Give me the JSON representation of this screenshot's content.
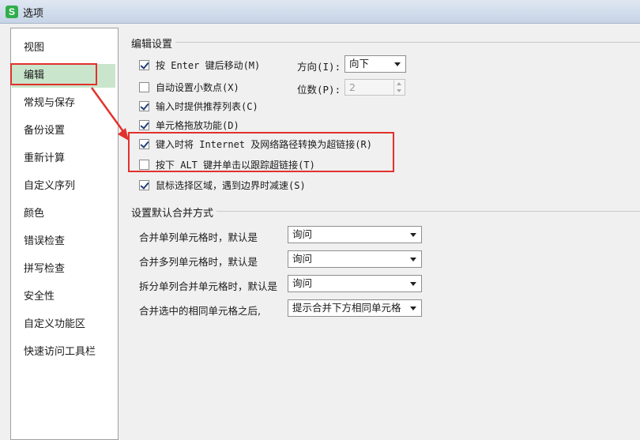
{
  "window": {
    "logo_letter": "S",
    "title": "选项"
  },
  "sidebar": {
    "items": [
      {
        "label": "视图"
      },
      {
        "label": "编辑"
      },
      {
        "label": "常规与保存"
      },
      {
        "label": "备份设置"
      },
      {
        "label": "重新计算"
      },
      {
        "label": "自定义序列"
      },
      {
        "label": "颜色"
      },
      {
        "label": "错误检查"
      },
      {
        "label": "拼写检查"
      },
      {
        "label": "安全性"
      },
      {
        "label": "自定义功能区"
      },
      {
        "label": "快速访问工具栏"
      }
    ],
    "active_index": 1
  },
  "edit_settings": {
    "group_title": "编辑设置",
    "options": [
      {
        "label": "按 Enter 键后移动(M)",
        "checked": true
      },
      {
        "label": "自动设置小数点(X)",
        "checked": false
      },
      {
        "label": "输入时提供推荐列表(C)",
        "checked": true
      },
      {
        "label": "单元格拖放功能(D)",
        "checked": true
      },
      {
        "label": "键入时将 Internet 及网络路径转换为超链接(R)",
        "checked": true
      },
      {
        "label": "按下 ALT 键并单击以跟踪超链接(T)",
        "checked": false
      },
      {
        "label": "鼠标选择区域，遇到边界时减速(S)",
        "checked": true
      }
    ],
    "direction_label": "方向(I):",
    "direction_value": "向下",
    "digits_label": "位数(P):",
    "digits_value": "2"
  },
  "merge_settings": {
    "group_title": "设置默认合并方式",
    "rows": [
      {
        "label": "合并单列单元格时，默认是",
        "value": "询问"
      },
      {
        "label": "合并多列单元格时，默认是",
        "value": "询问"
      },
      {
        "label": "拆分单列合并单元格时，默认是",
        "value": "询问"
      },
      {
        "label": "合并选中的相同单元格之后,",
        "value": "提示合并下方相同单元格"
      }
    ]
  },
  "annotation": {
    "color": "#e2312d"
  }
}
